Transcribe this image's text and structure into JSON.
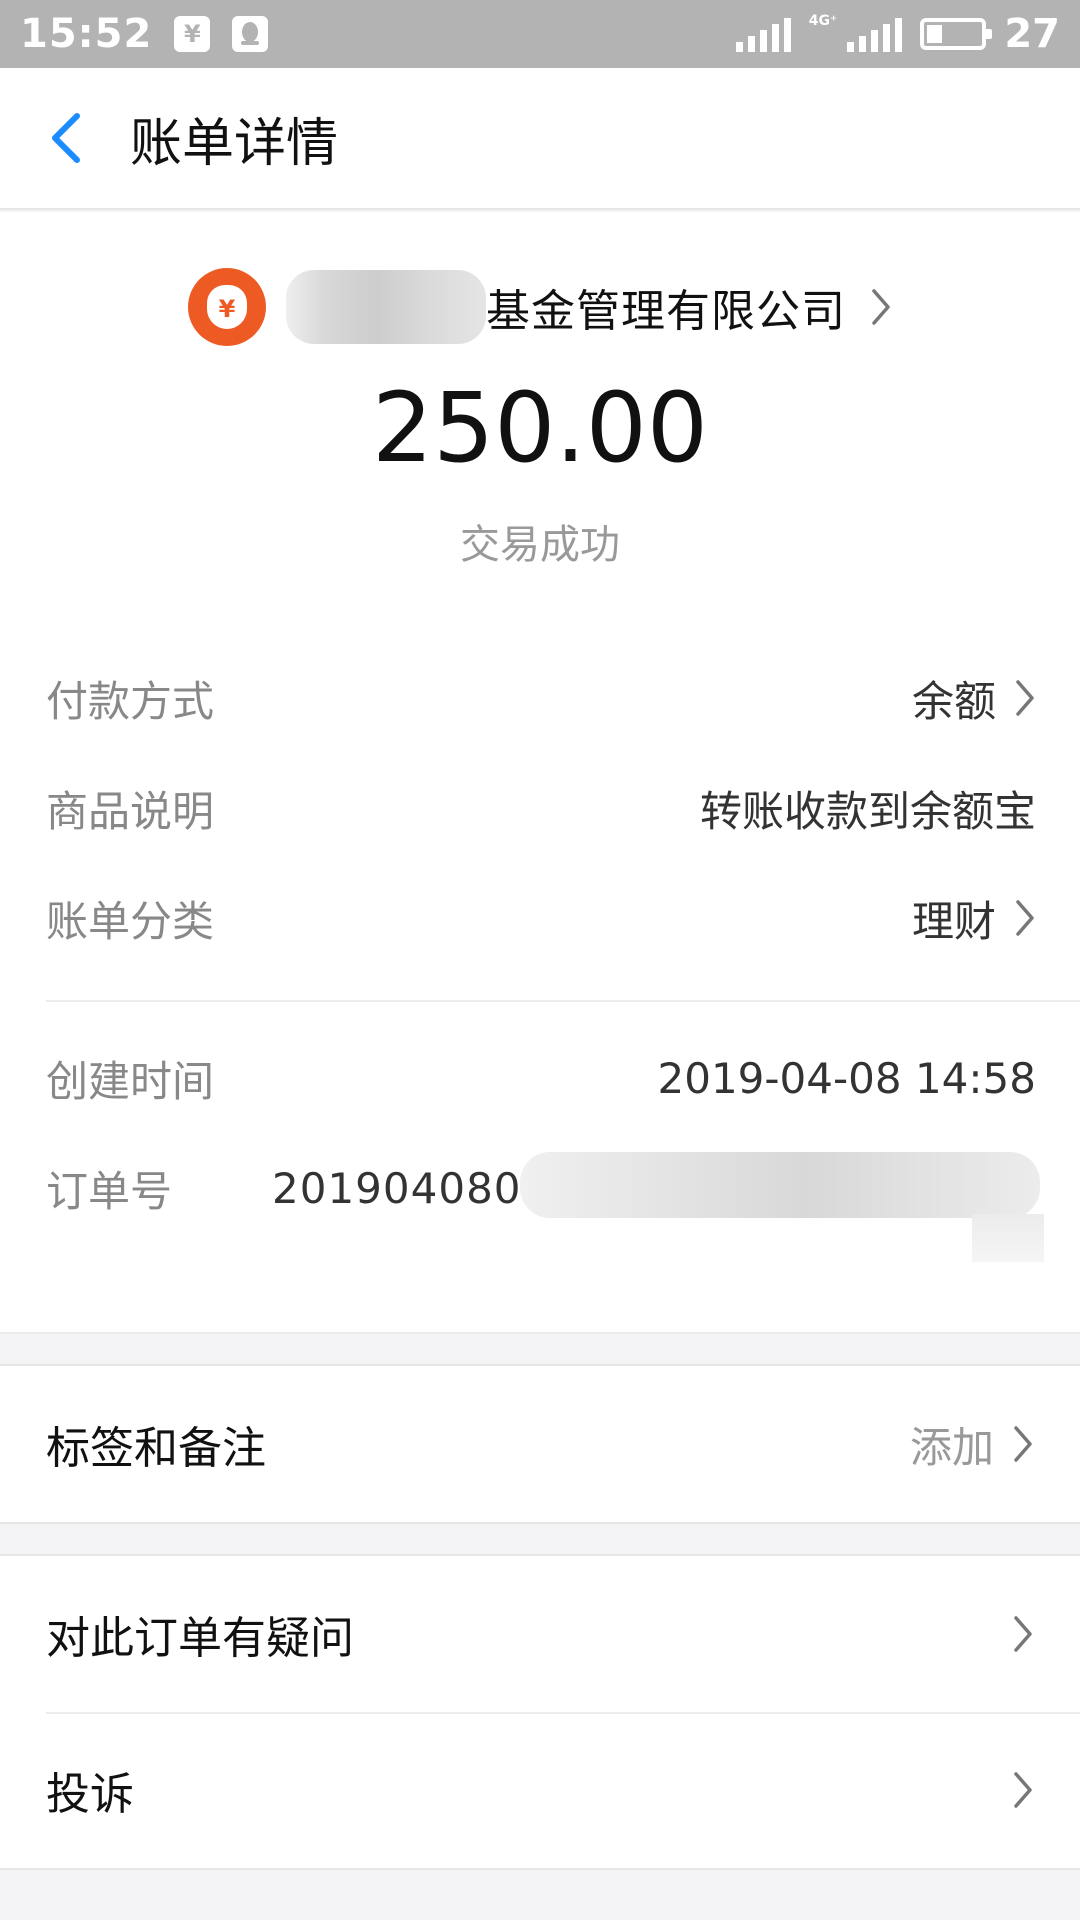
{
  "status_bar": {
    "time": "15:52",
    "shield_glyph": "¥",
    "network": "4G⁺",
    "battery_percent": "27",
    "battery_level": 0.27
  },
  "nav": {
    "title": "账单详情"
  },
  "merchant": {
    "logo_glyph": "¥",
    "name": "基金管理有限公司",
    "logo_color": "#ee5a24"
  },
  "transaction": {
    "amount": "250.00",
    "status": "交易成功"
  },
  "details": [
    {
      "label": "付款方式",
      "value": "余额"
    },
    {
      "label": "商品说明",
      "value": "转账收款到余额宝"
    },
    {
      "label": "账单分类",
      "value": "理财"
    },
    {
      "label": "创建时间",
      "value": "2019-04-08 14:58"
    },
    {
      "label": "订单号",
      "value": "2019040800"
    }
  ],
  "tags": {
    "label": "标签和备注",
    "action": "添加"
  },
  "actions": [
    {
      "label": "对此订单有疑问"
    },
    {
      "label": "投诉"
    }
  ],
  "colors": {
    "accent": "#1a8cff",
    "status_bar": "#b3b3b3"
  }
}
